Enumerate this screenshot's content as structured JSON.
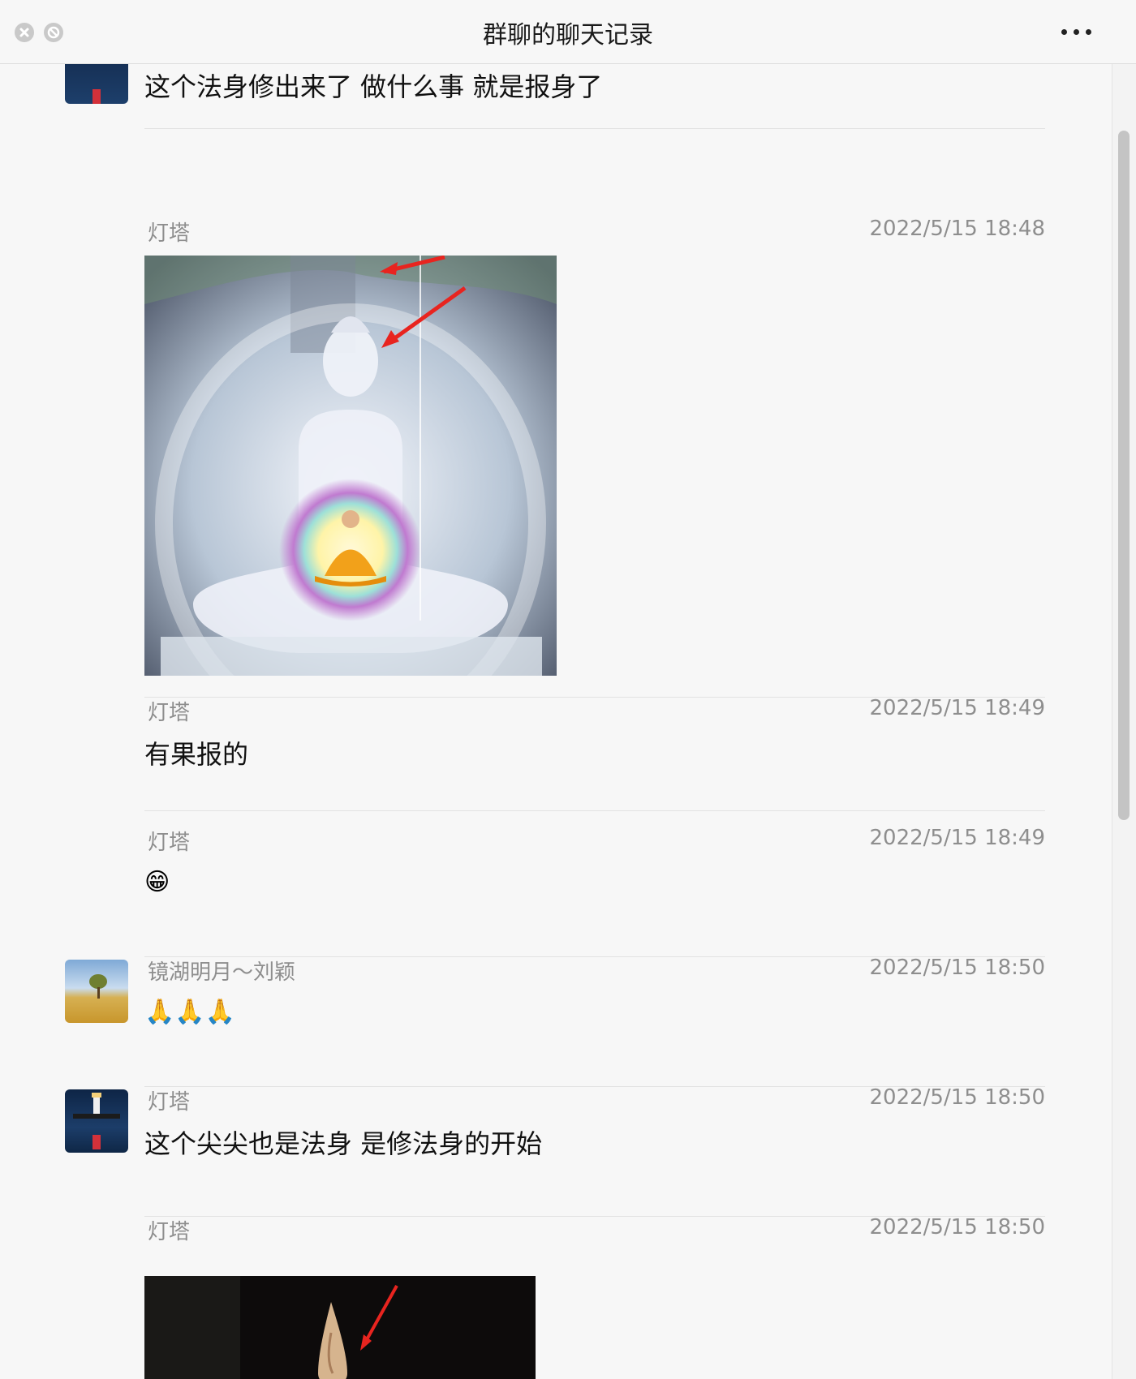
{
  "window": {
    "title": "群聊的聊天记录"
  },
  "icons": {
    "close": "close-icon",
    "block": "block-icon",
    "more": "more-icon"
  },
  "messages": [
    {
      "text": "这个法身修出来了  做什么事  就是报身了"
    },
    {
      "sender": "灯塔",
      "time": "2022/5/15 18:48",
      "image": "buddha-aura-image"
    },
    {
      "sender": "灯塔",
      "time": "2022/5/15 18:49",
      "text": "有果报的"
    },
    {
      "sender": "灯塔",
      "time": "2022/5/15 18:49",
      "emoji": "😁"
    },
    {
      "sender": "镜湖明月～刘颖",
      "time": "2022/5/15 18:50",
      "emoji": "🙏🙏🙏"
    },
    {
      "sender": "灯塔",
      "time": "2022/5/15 18:50",
      "text": "这个尖尖也是法身  是修法身的开始"
    },
    {
      "sender": "灯塔",
      "time": "2022/5/15 18:50",
      "image": "statue-crown-image"
    }
  ],
  "colors": {
    "background": "#f7f7f7",
    "meta_text": "#8e8e8e",
    "body_text": "#111111",
    "arrow": "#e8241f"
  }
}
